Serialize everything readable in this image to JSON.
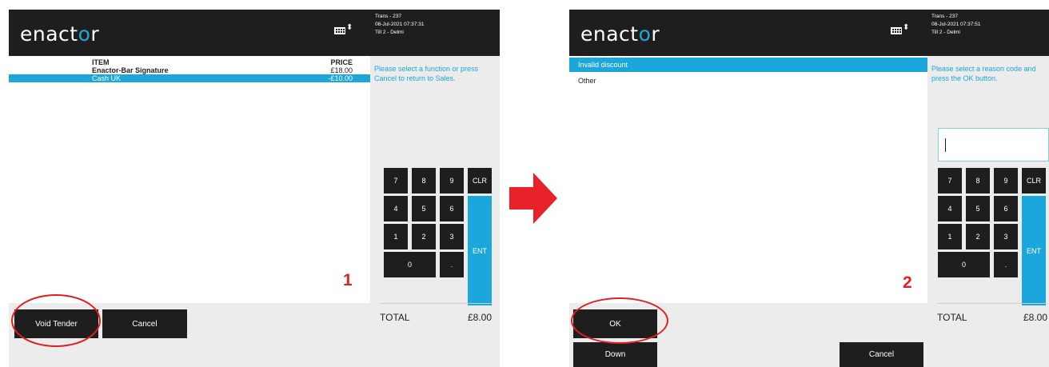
{
  "brand": {
    "logo_main": "enact",
    "logo_o": "o",
    "logo_end": "r"
  },
  "screen1": {
    "trans": "Trans - 237",
    "datetime": "08-Jul-2021 07:37:31",
    "till": "Till 2 - Delmi",
    "table": {
      "col_item": "ITEM",
      "col_price": "PRICE",
      "rows": [
        {
          "item": "Enactor-Bar Signature",
          "price": "£18.00",
          "selected": false
        },
        {
          "item": "Cash UK",
          "price": "-£10.00",
          "selected": true
        }
      ]
    },
    "prompt": "Please select a function or press Cancel to return to Sales.",
    "step": "1",
    "total_label": "TOTAL",
    "total_value": "£8.00",
    "buttons": {
      "void_tender": "Void Tender",
      "cancel": "Cancel"
    }
  },
  "screen2": {
    "trans": "Trans - 237",
    "datetime": "08-Jul-2021 07:37:51",
    "till": "Till 2 - Delmi",
    "reasons": [
      {
        "label": "Invalid discount",
        "selected": true
      },
      {
        "label": "Other",
        "selected": false
      }
    ],
    "prompt": "Please select a reason code and press the OK button.",
    "input_value": "",
    "step": "2",
    "total_label": "TOTAL",
    "total_value": "£8.00",
    "buttons": {
      "ok": "OK",
      "down": "Down",
      "cancel": "Cancel"
    }
  },
  "keypad": {
    "k7": "7",
    "k8": "8",
    "k9": "9",
    "clr": "CLR",
    "k4": "4",
    "k5": "5",
    "k6": "6",
    "k1": "1",
    "k2": "2",
    "k3": "3",
    "ent": "ENT",
    "k0": "0",
    "dot": "."
  },
  "colors": {
    "accent": "#1ba7dc",
    "header": "#1e1e1e",
    "highlight": "#e02020",
    "panel": "#ececec"
  }
}
